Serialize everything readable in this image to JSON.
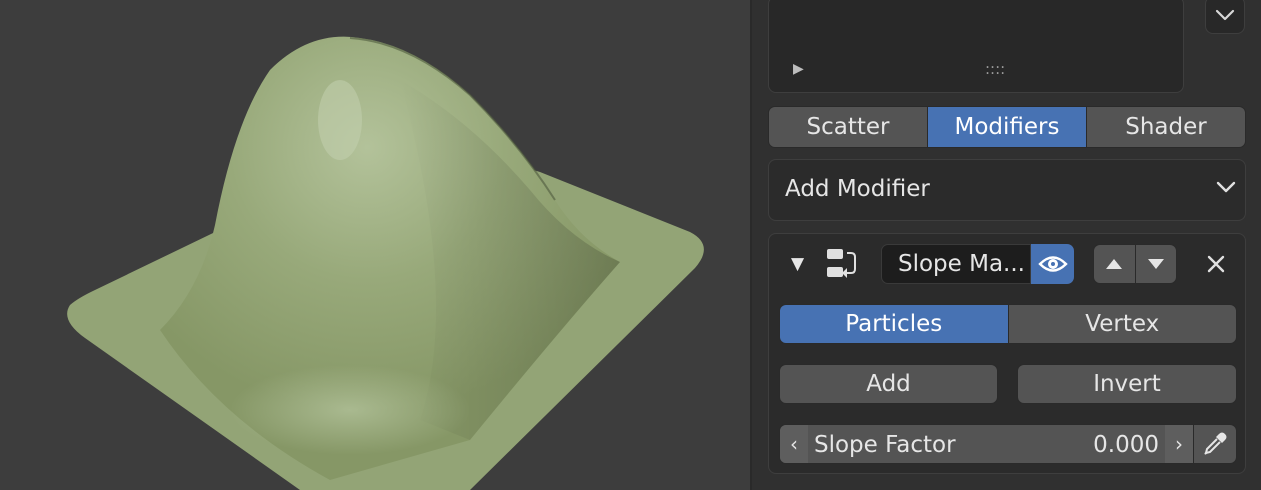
{
  "list": {
    "play_glyph": "▶",
    "grip_glyph": "::::"
  },
  "tabs": [
    {
      "label": "Scatter",
      "active": false
    },
    {
      "label": "Modifiers",
      "active": true
    },
    {
      "label": "Shader",
      "active": false
    }
  ],
  "add_modifier": {
    "label": "Add Modifier"
  },
  "modifier": {
    "collapse_glyph": "▼",
    "type_icon": "slope-mask-icon",
    "name": "Slope Ma...",
    "visibility_icon": "eye-icon",
    "move_up_icon": "move-up-icon",
    "move_down_icon": "move-down-icon",
    "remove_icon": "close-icon",
    "target_options": [
      {
        "label": "Particles",
        "active": true
      },
      {
        "label": "Vertex",
        "active": false
      }
    ],
    "add_label": "Add",
    "invert_label": "Invert",
    "slope_factor": {
      "label": "Slope Factor",
      "value": "0.000",
      "decrement_glyph": "‹",
      "increment_glyph": "›"
    },
    "eyedropper_icon": "eyedropper-icon"
  },
  "colors": {
    "accent": "#4772b3",
    "mesh": "#93a476",
    "viewport_bg": "#3d3d3d",
    "panel_bg": "#303030"
  }
}
